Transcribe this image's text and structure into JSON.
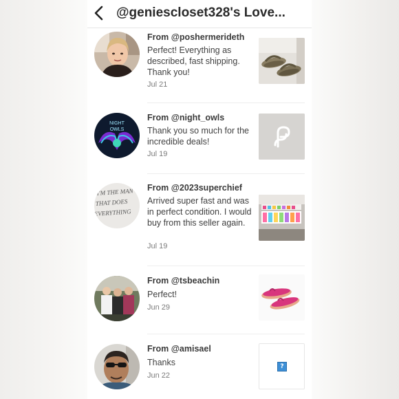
{
  "header": {
    "title": "@geniescloset328's Love...",
    "back_icon": "chevron-left-icon"
  },
  "reviews": [
    {
      "from_label": "From",
      "handle": "@poshermerideth",
      "message": "Perfect! Everything as described, fast shipping. Thank you!",
      "date": "Jul 21",
      "thumb_icon": "sandals-photo"
    },
    {
      "from_label": "From",
      "handle": "@night_owls",
      "message": "Thank you so much for the incredible deals!",
      "date": "Jul 19",
      "thumb_icon": "poshmark-logo-icon",
      "avatar_text_top": "NIGHT",
      "avatar_text_mid": "OWLS"
    },
    {
      "from_label": "From",
      "handle": "@2023superchief",
      "message": "Arrived super fast and was in perfect condition. I would buy from this seller again.",
      "date": "Jul 19",
      "thumb_icon": "products-photo",
      "avatar_text": "I'M THE MAN THAT DOES EVERYTHING"
    },
    {
      "from_label": "From",
      "handle": "@tsbeachin",
      "message": "Perfect!",
      "date": "Jun 29",
      "thumb_icon": "flip-flops-photo"
    },
    {
      "from_label": "From",
      "handle": "@amisael",
      "message": "Thanks",
      "date": "Jun 22",
      "thumb_icon": "broken-image-icon",
      "thumb_text": "?"
    }
  ],
  "colors": {
    "poshmark_placeholder": "#d6d4d1",
    "owl_bg": "#0e1a2e",
    "flip_flop": "#d8357d"
  }
}
